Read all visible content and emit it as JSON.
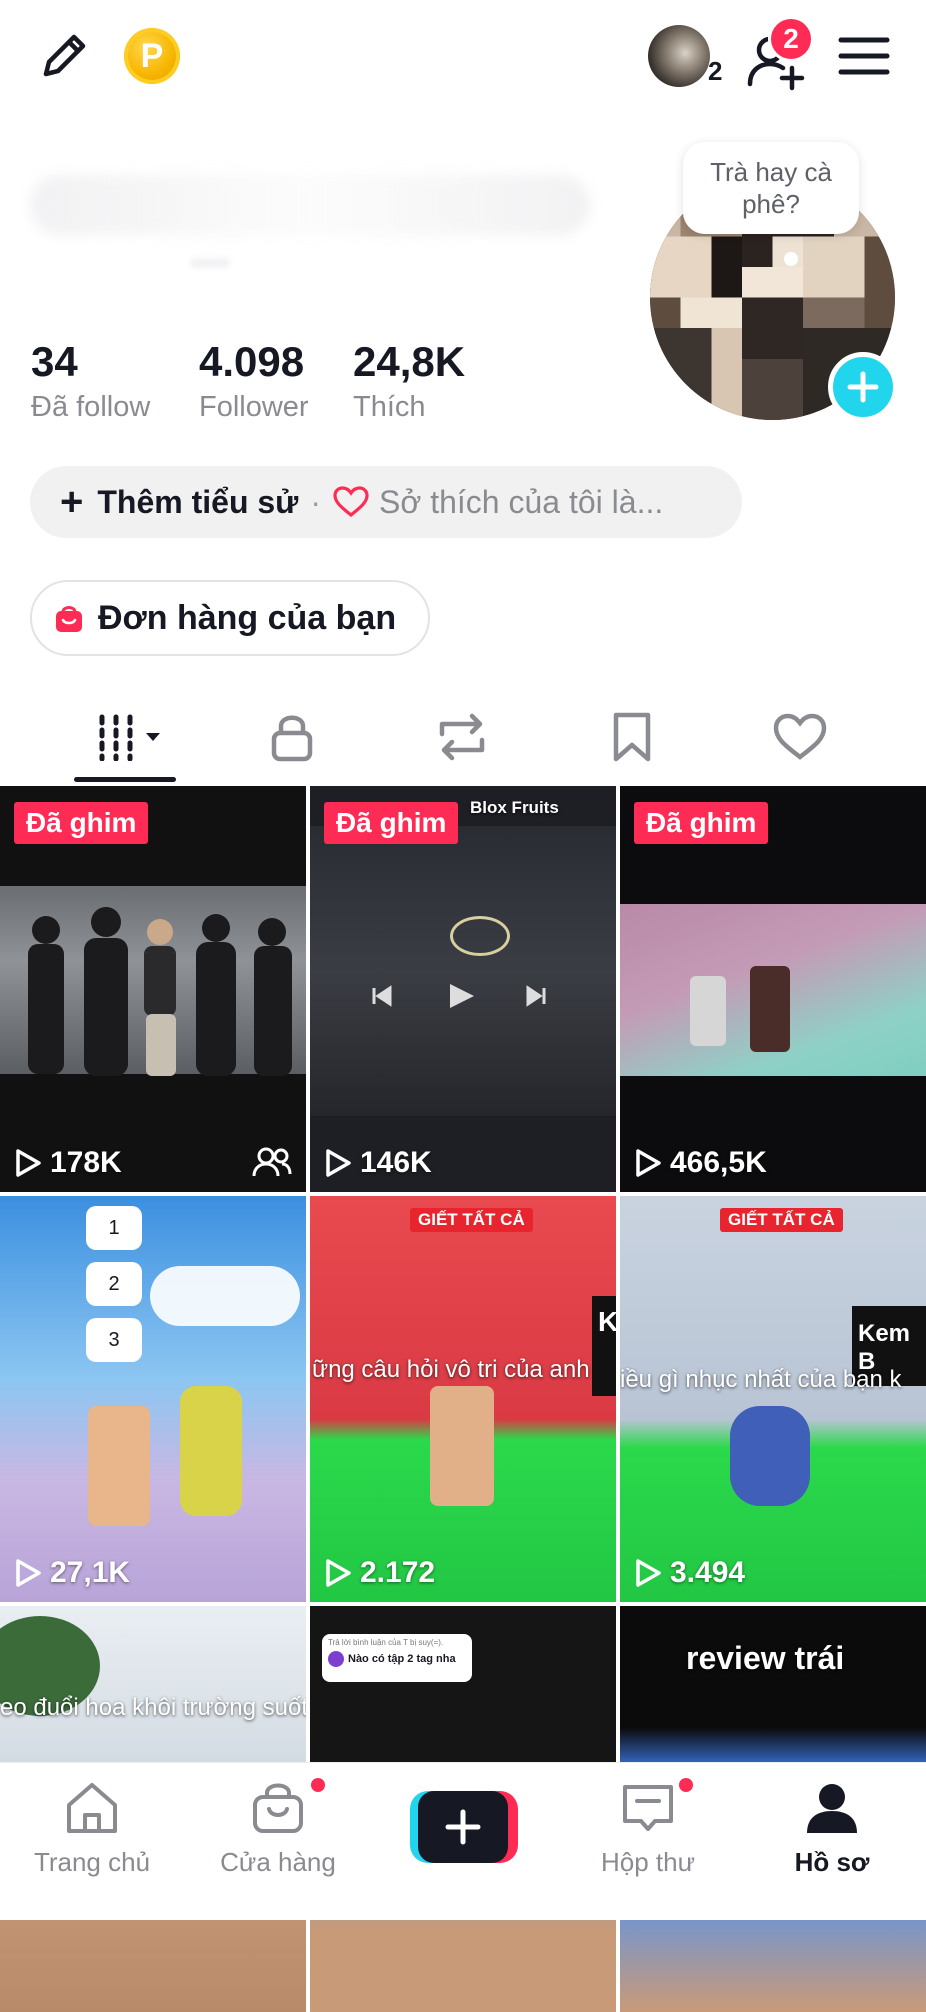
{
  "header": {
    "edit_icon": "pencil-icon",
    "coin_letter": "P",
    "avatar_count": "2",
    "friend_badge": "2",
    "menu_icon": "hamburger-icon"
  },
  "profile": {
    "bubble_text": "Trà hay cà phê?",
    "stats": [
      {
        "value": "34",
        "label": "Đã follow"
      },
      {
        "value": "4.098",
        "label": "Follower"
      },
      {
        "value": "24,8K",
        "label": "Thích"
      }
    ],
    "bio_button": "Thêm tiểu sử",
    "bio_separator": "·",
    "interests_text": "Sở thích của tôi là...",
    "orders_button": "Đơn hàng của bạn"
  },
  "tabs": [
    "videos",
    "private",
    "reposts",
    "favorites",
    "liked"
  ],
  "grid": [
    {
      "pinned": "Đã ghim",
      "views": "178K"
    },
    {
      "pinned": "Đã ghim",
      "views": "146K",
      "overlay": "Blox Fruits"
    },
    {
      "pinned": "Đã ghim",
      "views": "466,5K"
    },
    {
      "views": "27,1K",
      "list_items": [
        "1",
        "2",
        "3"
      ]
    },
    {
      "views": "2.172",
      "tag": "GIẾT TẤT CẢ",
      "overlay": "ững câu hỏi vô tri của anh",
      "side_letter": "K"
    },
    {
      "views": "3.494",
      "tag": "GIẾT TẤT CẢ",
      "overlay": "iều gì nhục nhất của bạn k",
      "side_text": "Kem B"
    },
    {
      "overlay": "eo đuổi hoa khôi trường suốt"
    },
    {
      "comment": "Nào có tập 2 tag nha",
      "comment_header": "Trả lời bình luận của T bị suy(=)."
    },
    {
      "overlay": "review trái"
    }
  ],
  "nav": [
    {
      "label": "Trang chủ",
      "icon": "home-icon"
    },
    {
      "label": "Cửa hàng",
      "icon": "shop-bag-icon"
    },
    {
      "label": "",
      "icon": "create-icon"
    },
    {
      "label": "Hộp thư",
      "icon": "inbox-icon"
    },
    {
      "label": "Hồ sơ",
      "icon": "profile-icon"
    }
  ],
  "colors": {
    "accent": "#fe2c55",
    "cyan": "#20d5ec",
    "text": "#161823",
    "muted": "#8a8b91"
  }
}
